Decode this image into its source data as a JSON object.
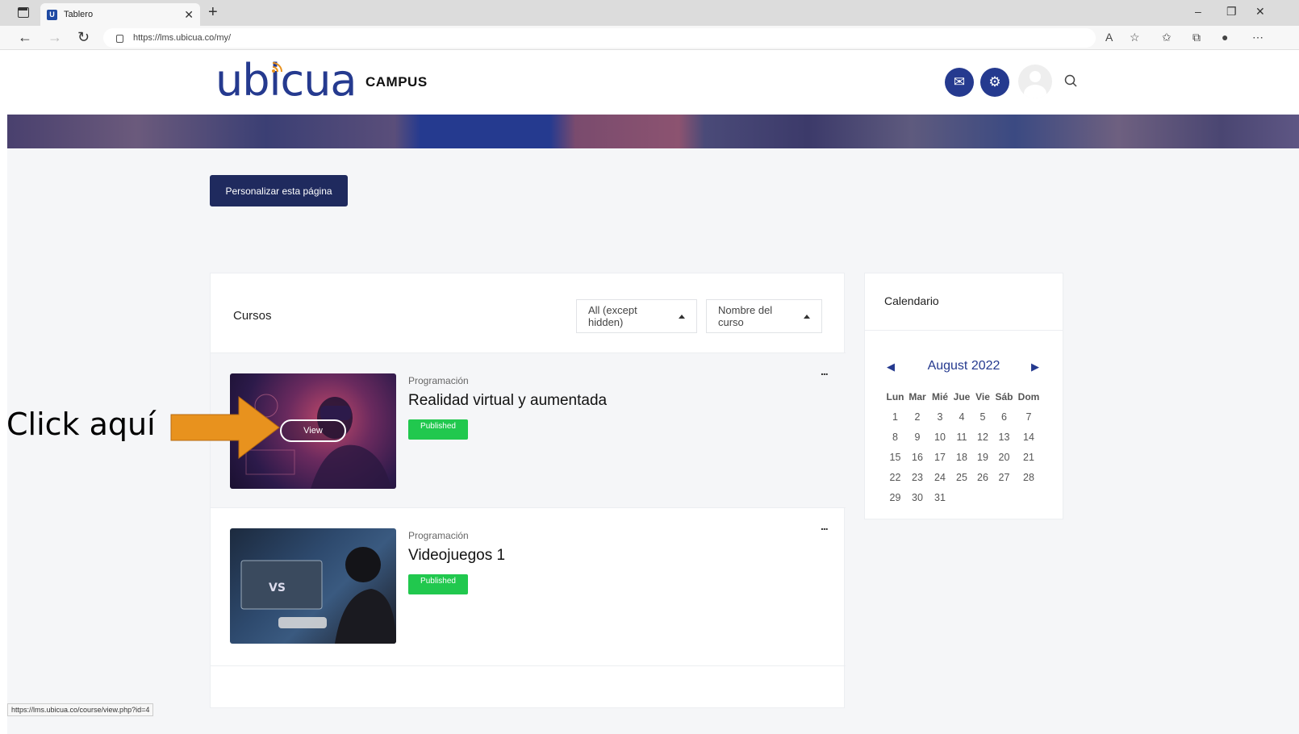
{
  "browser": {
    "tab_title": "Tablero",
    "tab_favicon": "U",
    "url": "https://lms.ubicua.co/my/",
    "status_url": "https://lms.ubicua.co/course/view.php?id=4"
  },
  "header": {
    "logo_text": "ubicua",
    "campus_label": "CAMPUS",
    "brand_color": "#253a8f"
  },
  "main": {
    "customize_button": "Personalizar esta página",
    "courses": {
      "title": "Cursos",
      "filter_label": "All (except hidden)",
      "sort_label": "Nombre del curso",
      "items": [
        {
          "category": "Programación",
          "name": "Realidad virtual y aumentada",
          "badge": "Published",
          "view_label": "View"
        },
        {
          "category": "Programación",
          "name": "Videojuegos 1",
          "badge": "Published"
        }
      ],
      "more_menu": "..."
    },
    "calendar": {
      "title": "Calendario",
      "month": "August 2022",
      "weekdays": [
        "Lun",
        "Mar",
        "Mié",
        "Jue",
        "Vie",
        "Sáb",
        "Dom"
      ],
      "weeks": [
        [
          "1",
          "2",
          "3",
          "4",
          "5",
          "6",
          "7"
        ],
        [
          "8",
          "9",
          "10",
          "11",
          "12",
          "13",
          "14"
        ],
        [
          "15",
          "16",
          "17",
          "18",
          "19",
          "20",
          "21"
        ],
        [
          "22",
          "23",
          "24",
          "25",
          "26",
          "27",
          "28"
        ],
        [
          "29",
          "30",
          "31",
          "",
          "",
          "",
          ""
        ]
      ]
    }
  },
  "annotation": {
    "text": "Click aquí",
    "arrow_color": "#e8921e"
  }
}
